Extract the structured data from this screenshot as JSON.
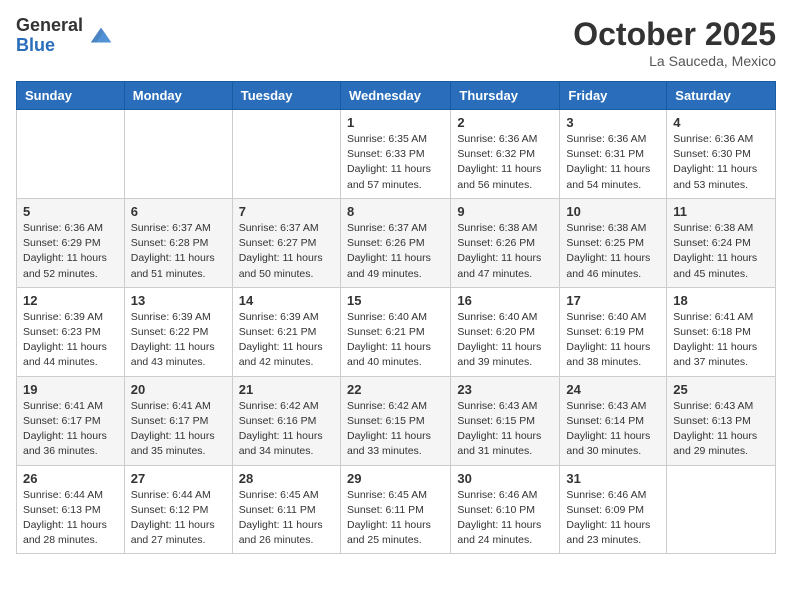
{
  "header": {
    "logo": {
      "line1": "General",
      "line2": "Blue"
    },
    "title": "October 2025",
    "location": "La Sauceda, Mexico"
  },
  "days_of_week": [
    "Sunday",
    "Monday",
    "Tuesday",
    "Wednesday",
    "Thursday",
    "Friday",
    "Saturday"
  ],
  "weeks": [
    [
      {
        "day": "",
        "sunrise": "",
        "sunset": "",
        "daylight": ""
      },
      {
        "day": "",
        "sunrise": "",
        "sunset": "",
        "daylight": ""
      },
      {
        "day": "",
        "sunrise": "",
        "sunset": "",
        "daylight": ""
      },
      {
        "day": "1",
        "sunrise": "Sunrise: 6:35 AM",
        "sunset": "Sunset: 6:33 PM",
        "daylight": "Daylight: 11 hours and 57 minutes."
      },
      {
        "day": "2",
        "sunrise": "Sunrise: 6:36 AM",
        "sunset": "Sunset: 6:32 PM",
        "daylight": "Daylight: 11 hours and 56 minutes."
      },
      {
        "day": "3",
        "sunrise": "Sunrise: 6:36 AM",
        "sunset": "Sunset: 6:31 PM",
        "daylight": "Daylight: 11 hours and 54 minutes."
      },
      {
        "day": "4",
        "sunrise": "Sunrise: 6:36 AM",
        "sunset": "Sunset: 6:30 PM",
        "daylight": "Daylight: 11 hours and 53 minutes."
      }
    ],
    [
      {
        "day": "5",
        "sunrise": "Sunrise: 6:36 AM",
        "sunset": "Sunset: 6:29 PM",
        "daylight": "Daylight: 11 hours and 52 minutes."
      },
      {
        "day": "6",
        "sunrise": "Sunrise: 6:37 AM",
        "sunset": "Sunset: 6:28 PM",
        "daylight": "Daylight: 11 hours and 51 minutes."
      },
      {
        "day": "7",
        "sunrise": "Sunrise: 6:37 AM",
        "sunset": "Sunset: 6:27 PM",
        "daylight": "Daylight: 11 hours and 50 minutes."
      },
      {
        "day": "8",
        "sunrise": "Sunrise: 6:37 AM",
        "sunset": "Sunset: 6:26 PM",
        "daylight": "Daylight: 11 hours and 49 minutes."
      },
      {
        "day": "9",
        "sunrise": "Sunrise: 6:38 AM",
        "sunset": "Sunset: 6:26 PM",
        "daylight": "Daylight: 11 hours and 47 minutes."
      },
      {
        "day": "10",
        "sunrise": "Sunrise: 6:38 AM",
        "sunset": "Sunset: 6:25 PM",
        "daylight": "Daylight: 11 hours and 46 minutes."
      },
      {
        "day": "11",
        "sunrise": "Sunrise: 6:38 AM",
        "sunset": "Sunset: 6:24 PM",
        "daylight": "Daylight: 11 hours and 45 minutes."
      }
    ],
    [
      {
        "day": "12",
        "sunrise": "Sunrise: 6:39 AM",
        "sunset": "Sunset: 6:23 PM",
        "daylight": "Daylight: 11 hours and 44 minutes."
      },
      {
        "day": "13",
        "sunrise": "Sunrise: 6:39 AM",
        "sunset": "Sunset: 6:22 PM",
        "daylight": "Daylight: 11 hours and 43 minutes."
      },
      {
        "day": "14",
        "sunrise": "Sunrise: 6:39 AM",
        "sunset": "Sunset: 6:21 PM",
        "daylight": "Daylight: 11 hours and 42 minutes."
      },
      {
        "day": "15",
        "sunrise": "Sunrise: 6:40 AM",
        "sunset": "Sunset: 6:21 PM",
        "daylight": "Daylight: 11 hours and 40 minutes."
      },
      {
        "day": "16",
        "sunrise": "Sunrise: 6:40 AM",
        "sunset": "Sunset: 6:20 PM",
        "daylight": "Daylight: 11 hours and 39 minutes."
      },
      {
        "day": "17",
        "sunrise": "Sunrise: 6:40 AM",
        "sunset": "Sunset: 6:19 PM",
        "daylight": "Daylight: 11 hours and 38 minutes."
      },
      {
        "day": "18",
        "sunrise": "Sunrise: 6:41 AM",
        "sunset": "Sunset: 6:18 PM",
        "daylight": "Daylight: 11 hours and 37 minutes."
      }
    ],
    [
      {
        "day": "19",
        "sunrise": "Sunrise: 6:41 AM",
        "sunset": "Sunset: 6:17 PM",
        "daylight": "Daylight: 11 hours and 36 minutes."
      },
      {
        "day": "20",
        "sunrise": "Sunrise: 6:41 AM",
        "sunset": "Sunset: 6:17 PM",
        "daylight": "Daylight: 11 hours and 35 minutes."
      },
      {
        "day": "21",
        "sunrise": "Sunrise: 6:42 AM",
        "sunset": "Sunset: 6:16 PM",
        "daylight": "Daylight: 11 hours and 34 minutes."
      },
      {
        "day": "22",
        "sunrise": "Sunrise: 6:42 AM",
        "sunset": "Sunset: 6:15 PM",
        "daylight": "Daylight: 11 hours and 33 minutes."
      },
      {
        "day": "23",
        "sunrise": "Sunrise: 6:43 AM",
        "sunset": "Sunset: 6:15 PM",
        "daylight": "Daylight: 11 hours and 31 minutes."
      },
      {
        "day": "24",
        "sunrise": "Sunrise: 6:43 AM",
        "sunset": "Sunset: 6:14 PM",
        "daylight": "Daylight: 11 hours and 30 minutes."
      },
      {
        "day": "25",
        "sunrise": "Sunrise: 6:43 AM",
        "sunset": "Sunset: 6:13 PM",
        "daylight": "Daylight: 11 hours and 29 minutes."
      }
    ],
    [
      {
        "day": "26",
        "sunrise": "Sunrise: 6:44 AM",
        "sunset": "Sunset: 6:13 PM",
        "daylight": "Daylight: 11 hours and 28 minutes."
      },
      {
        "day": "27",
        "sunrise": "Sunrise: 6:44 AM",
        "sunset": "Sunset: 6:12 PM",
        "daylight": "Daylight: 11 hours and 27 minutes."
      },
      {
        "day": "28",
        "sunrise": "Sunrise: 6:45 AM",
        "sunset": "Sunset: 6:11 PM",
        "daylight": "Daylight: 11 hours and 26 minutes."
      },
      {
        "day": "29",
        "sunrise": "Sunrise: 6:45 AM",
        "sunset": "Sunset: 6:11 PM",
        "daylight": "Daylight: 11 hours and 25 minutes."
      },
      {
        "day": "30",
        "sunrise": "Sunrise: 6:46 AM",
        "sunset": "Sunset: 6:10 PM",
        "daylight": "Daylight: 11 hours and 24 minutes."
      },
      {
        "day": "31",
        "sunrise": "Sunrise: 6:46 AM",
        "sunset": "Sunset: 6:09 PM",
        "daylight": "Daylight: 11 hours and 23 minutes."
      },
      {
        "day": "",
        "sunrise": "",
        "sunset": "",
        "daylight": ""
      }
    ]
  ]
}
